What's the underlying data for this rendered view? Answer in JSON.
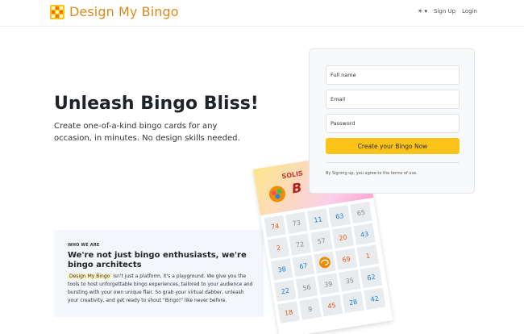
{
  "header": {
    "brand_name": "Design My Bingo",
    "logo_icon": "bingo-grid-logo-icon",
    "theme_toggle": "☀ ▾",
    "signup_link": "Sign Up",
    "login_link": "Login"
  },
  "hero": {
    "title": "Unleash Bingo Bliss!",
    "subtitle": "Create one-of-a-kind bingo cards for any occasion, in minutes. No design skills needed."
  },
  "signup_form": {
    "name_placeholder": "Full name",
    "email_placeholder": "Email",
    "password_placeholder": "Password",
    "submit_label": "Create your Bingo Now",
    "terms_note": "By Signing up, you agree to the terms of use."
  },
  "about": {
    "eyebrow": "WHO WE ARE",
    "heading": "We're not just bingo enthusiasts, we're bingo architects",
    "brand_highlight": "Design My Bingo",
    "body": " isn't just a platform, it's a playground. We give you the tools to host unforgettable bingo experiences, tailored to your audience and bursting with your own unique flair. So grab your virtual dabber, unleash your creativity, and get ready to shout \"Bingo!\" like never before."
  },
  "bingo_card": {
    "banner_text": "SOLIS",
    "banner_letter": "B",
    "free_icon": "brain-icon",
    "cells": [
      {
        "n": "74",
        "color": "#e8590c"
      },
      {
        "n": "73",
        "color": "#8a8a8a"
      },
      {
        "n": "11",
        "color": "#1c7ed6"
      },
      {
        "n": "63",
        "color": "#1c7ed6"
      },
      {
        "n": "65",
        "color": "#8a8a8a"
      },
      {
        "n": "2",
        "color": "#e8590c"
      },
      {
        "n": "72",
        "color": "#8a8a8a"
      },
      {
        "n": "57",
        "color": "#8a8a8a"
      },
      {
        "n": "20",
        "color": "#e8590c"
      },
      {
        "n": "43",
        "color": "#1c7ed6"
      },
      {
        "n": "38",
        "color": "#1c7ed6"
      },
      {
        "n": "67",
        "color": "#1c7ed6"
      },
      {
        "n": "",
        "color": "#e8590c"
      },
      {
        "n": "69",
        "color": "#e8590c"
      },
      {
        "n": "1",
        "color": "#e8590c"
      },
      {
        "n": "22",
        "color": "#1c7ed6"
      },
      {
        "n": "56",
        "color": "#8a8a8a"
      },
      {
        "n": "39",
        "color": "#8a8a8a"
      },
      {
        "n": "35",
        "color": "#8a8a8a"
      },
      {
        "n": "62",
        "color": "#1c7ed6"
      },
      {
        "n": "18",
        "color": "#e8590c"
      },
      {
        "n": "9",
        "color": "#8a8a8a"
      },
      {
        "n": "45",
        "color": "#e8590c"
      },
      {
        "n": "28",
        "color": "#1c7ed6"
      },
      {
        "n": "42",
        "color": "#1c7ed6"
      }
    ]
  },
  "colors": {
    "brand": "#dc8a1e",
    "button": "#fcc419",
    "highlight": "#fff3bf"
  }
}
